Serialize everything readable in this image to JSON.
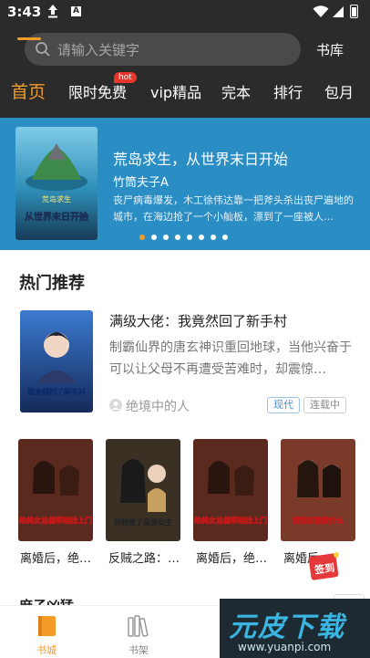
{
  "status": {
    "time": "3:43"
  },
  "search": {
    "placeholder": "请输入关键字",
    "shelf_label": "书库"
  },
  "tabs": [
    {
      "label": "首页",
      "active": true
    },
    {
      "label": "限时免费",
      "badge": "hot"
    },
    {
      "label": "vip精品"
    },
    {
      "label": "完本"
    },
    {
      "label": "排行"
    },
    {
      "label": "包月"
    }
  ],
  "banner": {
    "title": "荒岛求生，从世界末日开始",
    "author": "竹筒夫子A",
    "description": "丧尸病毒爆发，木工徐伟达靠一把斧头杀出丧尸遍地的城市，在海边抢了一个小舢板，漂到了一座被人…",
    "cover_text": "从世界末日开始",
    "cover_small": "荒岛求生",
    "slide_count": 8,
    "active_slide": 1
  },
  "hot": {
    "section_title": "热门推荐",
    "featured": {
      "title": "满级大佬：我竟然回了新手村",
      "description": "制霸仙界的唐玄神识重回地球，当他兴奋于可以让父母不再遭受苦难时，却震惊…",
      "author": "绝境中的人",
      "tags": [
        "现代",
        "连载中"
      ],
      "cover_text": "我竟然回了新手村"
    },
    "grid": [
      {
        "title": "离婚后，绝…",
        "cover_text": "绝美女总裁带娃找上门"
      },
      {
        "title": "反贼之路：…",
        "cover_text": "开局抢了和亲公主"
      },
      {
        "title": "离婚后，绝…",
        "cover_text": "绝美女总裁带娃找上门"
      },
      {
        "title": "离婚后，绝…",
        "cover_text": "挖我双眼做什么"
      }
    ]
  },
  "next_section": {
    "title": "庶子凶猛"
  },
  "sign_badge": "签到",
  "bottom_nav": [
    {
      "label": "书城",
      "active": true
    },
    {
      "label": "书架",
      "active": false
    }
  ],
  "watermark": {
    "brand": "元皮下载",
    "url": "www.yuanpi.com"
  },
  "colors": {
    "accent": "#f39c2a",
    "header_bg": "#2b2b2b",
    "banner_bg": "#2a8ec4",
    "hot_badge": "#e8352a"
  }
}
